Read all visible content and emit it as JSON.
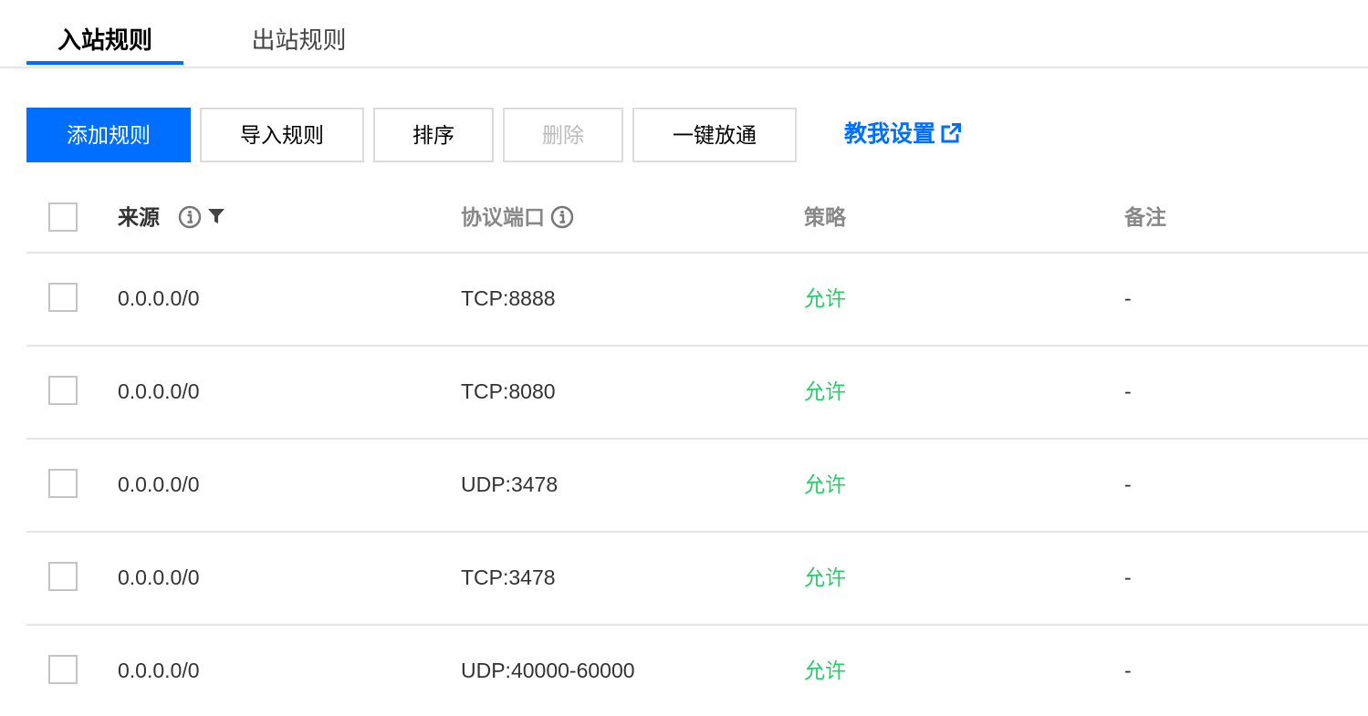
{
  "tabs": [
    {
      "label": "入站规则",
      "active": true
    },
    {
      "label": "出站规则",
      "active": false
    }
  ],
  "toolbar": {
    "add_label": "添加规则",
    "import_label": "导入规则",
    "sort_label": "排序",
    "delete_label": "删除",
    "open_all_label": "一键放通",
    "help_label": "教我设置"
  },
  "table": {
    "headers": {
      "source": "来源",
      "protocol_port": "协议端口",
      "policy": "策略",
      "note": "备注"
    },
    "rows": [
      {
        "source": "0.0.0.0/0",
        "protocol_port": "TCP:8888",
        "policy": "允许",
        "note": "-"
      },
      {
        "source": "0.0.0.0/0",
        "protocol_port": "TCP:8080",
        "policy": "允许",
        "note": "-"
      },
      {
        "source": "0.0.0.0/0",
        "protocol_port": "UDP:3478",
        "policy": "允许",
        "note": "-"
      },
      {
        "source": "0.0.0.0/0",
        "protocol_port": "TCP:3478",
        "policy": "允许",
        "note": "-"
      },
      {
        "source": "0.0.0.0/0",
        "protocol_port": "UDP:40000-60000",
        "policy": "允许",
        "note": "-"
      }
    ]
  },
  "colors": {
    "primary": "#006eff",
    "allow": "#29cc6a",
    "border": "#e5e5e5",
    "disabled_text": "#bbbbbb"
  },
  "icons": {
    "help_link": "external-link-icon",
    "header_info": "info-circle-icon",
    "header_filter": "filter-icon"
  }
}
